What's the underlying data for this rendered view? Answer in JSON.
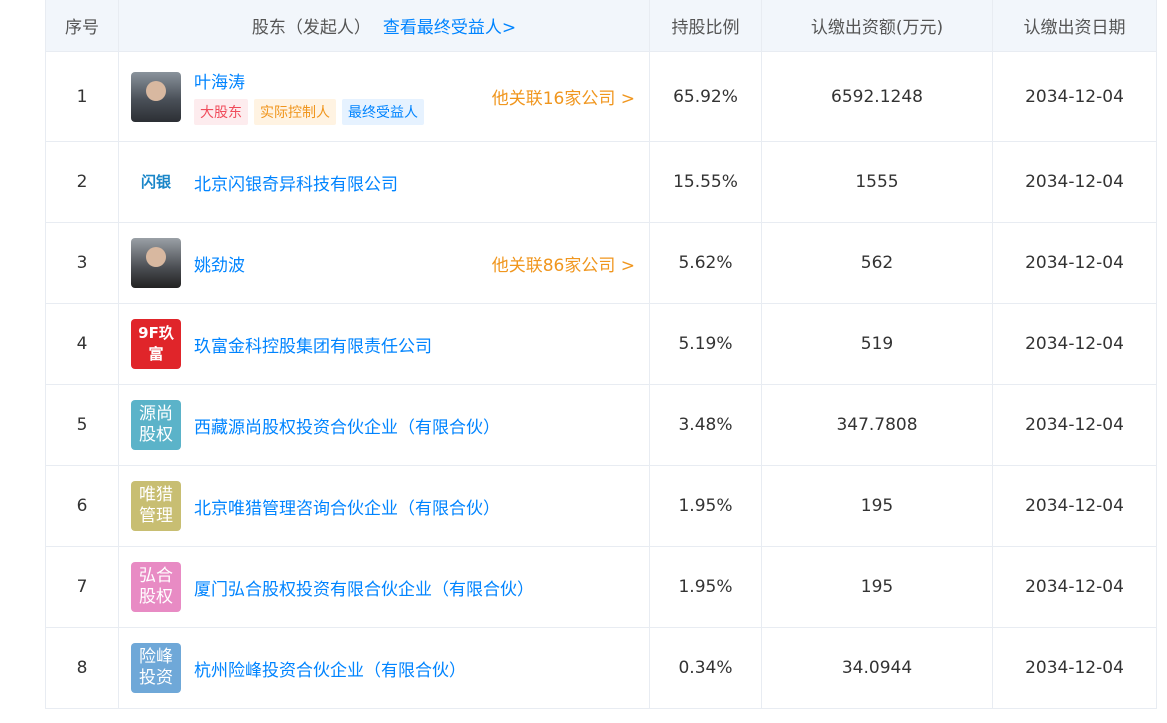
{
  "header": {
    "index": "序号",
    "shareholder": "股东（发起人）",
    "beneficiary_link": "查看最终受益人>",
    "ratio": "持股比例",
    "amount": "认缴出资额(万元)",
    "date": "认缴出资日期"
  },
  "rows": [
    {
      "index": "1",
      "name": "叶海涛",
      "avatar": "person-photo",
      "tags": [
        "大股东",
        "实际控制人",
        "最终受益人"
      ],
      "related": "他关联16家公司 >",
      "ratio": "65.92%",
      "amount": "6592.1248",
      "date": "2034-12-04"
    },
    {
      "index": "2",
      "name": "北京闪银奇异科技有限公司",
      "avatar": "logo-text",
      "logo": "闪银",
      "ratio": "15.55%",
      "amount": "1555",
      "date": "2034-12-04"
    },
    {
      "index": "3",
      "name": "姚劲波",
      "avatar": "person-photo",
      "related": "他关联86家公司 >",
      "ratio": "5.62%",
      "amount": "562",
      "date": "2034-12-04"
    },
    {
      "index": "4",
      "name": "玖富金科控股集团有限责任公司",
      "avatar": "logo-red",
      "logo": "9F玖富",
      "ratio": "5.19%",
      "amount": "519",
      "date": "2034-12-04"
    },
    {
      "index": "5",
      "name": "西藏源尚股权投资合伙企业（有限合伙）",
      "avatar": "text-badge",
      "logo": "源尚股权",
      "logo_color": "#5bb3c9",
      "ratio": "3.48%",
      "amount": "347.7808",
      "date": "2034-12-04"
    },
    {
      "index": "6",
      "name": "北京唯猎管理咨询合伙企业（有限合伙）",
      "avatar": "text-badge",
      "logo": "唯猎管理",
      "logo_color": "#c8be72",
      "ratio": "1.95%",
      "amount": "195",
      "date": "2034-12-04"
    },
    {
      "index": "7",
      "name": "厦门弘合股权投资有限合伙企业（有限合伙）",
      "avatar": "text-badge",
      "logo": "弘合股权",
      "logo_color": "#e88bc4",
      "ratio": "1.95%",
      "amount": "195",
      "date": "2034-12-04"
    },
    {
      "index": "8",
      "name": "杭州险峰投资合伙企业（有限合伙）",
      "avatar": "text-badge",
      "logo": "险峰投资",
      "logo_color": "#6fa8d8",
      "ratio": "0.34%",
      "amount": "34.0944",
      "date": "2034-12-04"
    }
  ],
  "colors": {
    "link": "#0084ff",
    "related": "#f0961e",
    "header_bg": "#f2f6fb"
  }
}
